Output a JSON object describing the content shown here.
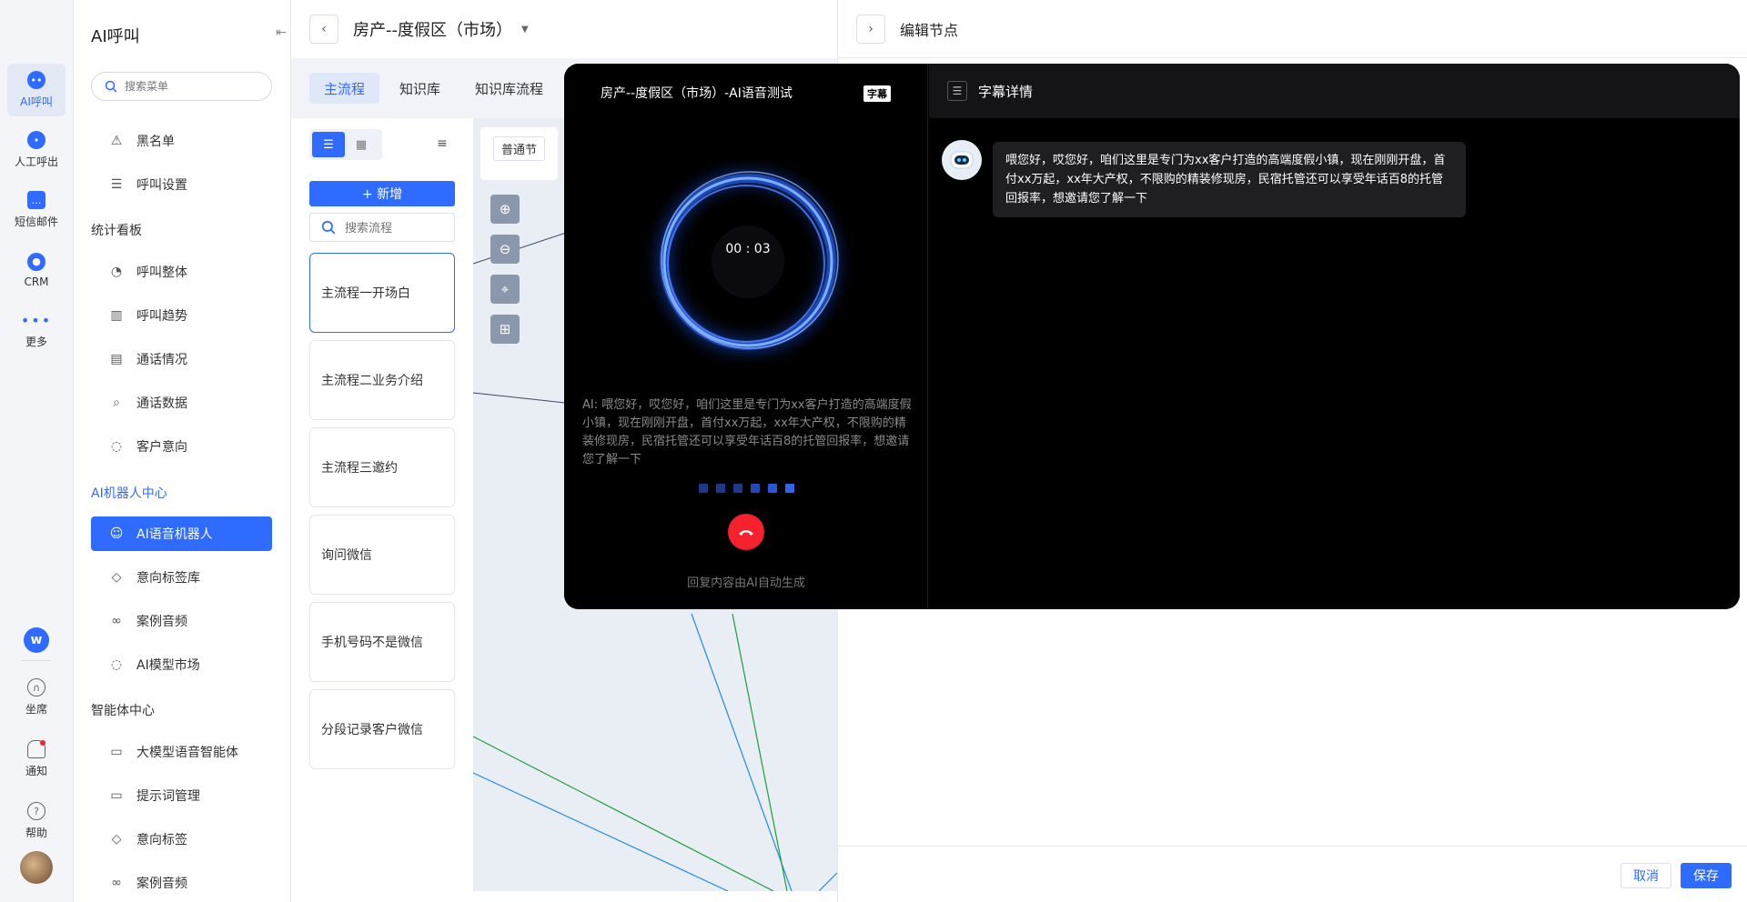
{
  "rail": {
    "items": [
      {
        "label": "AI呼叫",
        "icon": "ai-call-icon"
      },
      {
        "label": "人工呼出",
        "icon": "manual-call-icon"
      },
      {
        "label": "短信邮件",
        "icon": "sms-mail-icon"
      },
      {
        "label": "CRM",
        "icon": "crm-icon"
      },
      {
        "label": "更多",
        "icon": "more-icon"
      }
    ],
    "bottom": [
      {
        "label": "坐席",
        "icon": "headset-icon"
      },
      {
        "label": "通知",
        "icon": "bell-icon"
      },
      {
        "label": "帮助",
        "icon": "help-icon"
      }
    ]
  },
  "menu": {
    "title": "AI呼叫",
    "search_placeholder": "搜索菜单",
    "items": {
      "blacklist": "黑名单",
      "call_settings": "呼叫设置",
      "group_stats": "统计看板",
      "call_overall": "呼叫整体",
      "call_trend": "呼叫趋势",
      "call_status": "通话情况",
      "call_data": "通话数据",
      "customer_intent": "客户意向",
      "group_robot": "AI机器人中心",
      "voice_robot": "AI语音机器人",
      "intent_tags_lib": "意向标签库",
      "case_audio": "案例音频",
      "model_market": "AI模型市场",
      "group_agent": "智能体中心",
      "llm_voice_agent": "大模型语音智能体",
      "prompt_mgmt": "提示词管理",
      "intent_tags": "意向标签",
      "case_audio_2": "案例音频"
    }
  },
  "flow": {
    "title": "房产--度假区（市场）",
    "tabs": [
      "主流程",
      "知识库",
      "知识库流程"
    ],
    "add_label": "+ 新增",
    "search_placeholder": "搜索流程",
    "cards": [
      "主流程一开场白",
      "主流程二业务介绍",
      "主流程三邀约",
      "询问微信",
      "手机号码不是微信",
      "分段记录客户微信"
    ],
    "node_chip": "普通节"
  },
  "right": {
    "title": "编辑节点",
    "cancel": "取消",
    "save": "保存"
  },
  "call": {
    "title": "房产--度假区（市场）-AI语音测试",
    "subtitle_badge": "字幕",
    "timer": "00 : 03",
    "ai_text": "AI:  喂您好，哎您好，咱们这里是专门为xx客户打造的高端度假小镇，现在刚刚开盘，首付xx万起，xx年大产权，不限购的精装修现房，民宿托管还可以享受年话百8的托管回报率，想邀请您了解一下",
    "note": "回复内容由AI自动生成",
    "subtitle_panel_title": "字幕详情",
    "bubble_text": "喂您好，哎您好，咱们这里是专门为xx客户打造的高端度假小镇，现在刚刚开盘，首付xx万起，xx年大产权，不限购的精装修现房，民宿托管还可以享受年话百8的托管回报率，想邀请您了解一下"
  },
  "colors": {
    "accent": "#2f6bff",
    "danger": "#f5222d",
    "overlay": "#000000"
  }
}
